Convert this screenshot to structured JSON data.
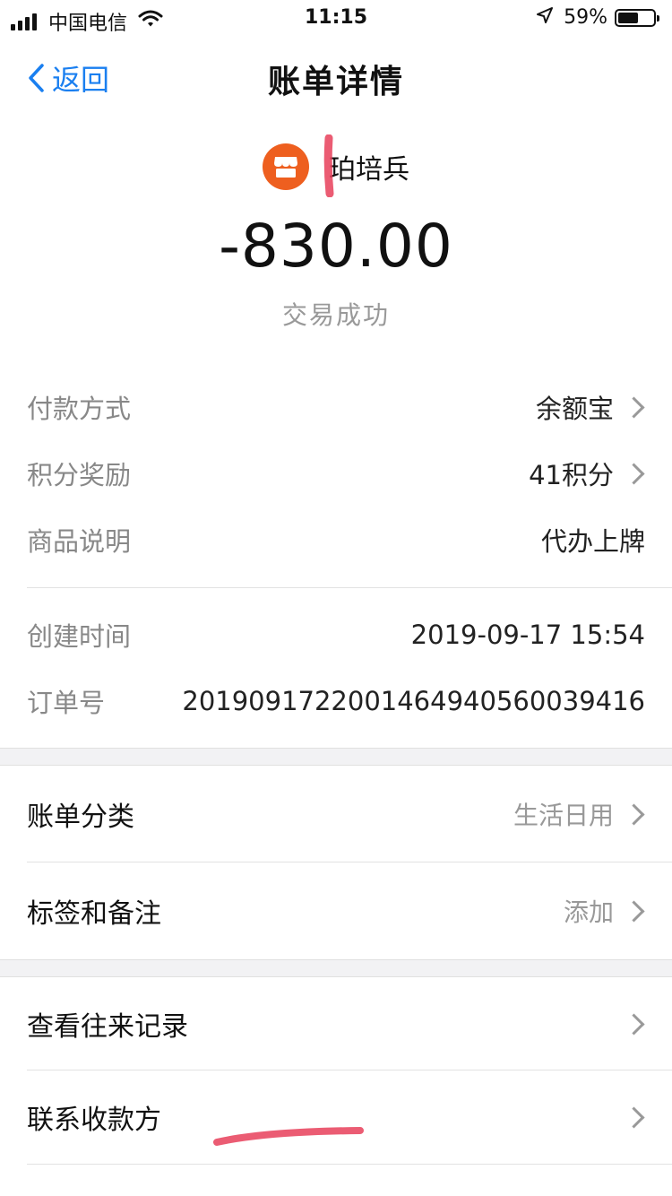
{
  "status_bar": {
    "carrier": "中国电信",
    "time": "11:15",
    "battery_percent": "59%",
    "battery_level": 0.59,
    "icons": [
      "signal-icon",
      "wifi-icon",
      "location-icon",
      "battery-icon"
    ]
  },
  "nav": {
    "back_label": "返回",
    "title": "账单详情"
  },
  "merchant": {
    "name": "珀培兵",
    "icon": "store-icon",
    "icon_color": "#ee5f1f"
  },
  "amount": "-830.00",
  "status": "交易成功",
  "details": [
    {
      "label": "付款方式",
      "value": "余额宝"
    },
    {
      "label": "积分奖励",
      "value": "41积分"
    },
    {
      "label": "商品说明",
      "value": "代办上牌"
    },
    {
      "label": "创建时间",
      "value": "2019-09-17 15:54"
    },
    {
      "label": "订单号",
      "value": "2019091722001464940560039416"
    }
  ],
  "menu": [
    {
      "label": "账单分类",
      "value": "生活日用"
    },
    {
      "label": "标签和备注",
      "value": "添加"
    },
    {
      "label": "查看往来记录",
      "value": ""
    },
    {
      "label": "联系收款方",
      "value": ""
    }
  ],
  "colors": {
    "accent": "#1a7ff0",
    "annotation": "#e8405a"
  }
}
